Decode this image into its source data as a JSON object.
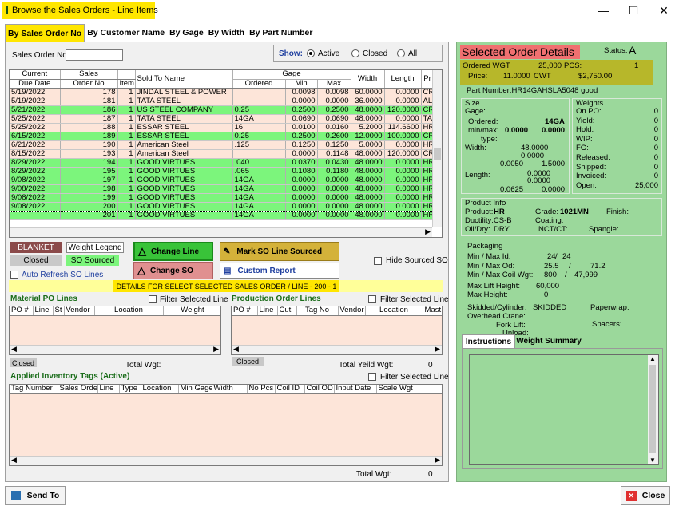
{
  "window": {
    "title": "Browse the Sales Orders - Line Items",
    "minimize": "—",
    "maximize": "☐",
    "close": "✕"
  },
  "tabs": [
    "By Sales Order No",
    "By Customer Name",
    "By Gage",
    "By Width",
    "By Part Number"
  ],
  "filters": {
    "sales_order_label": "Sales Order No:",
    "sales_order_value": "",
    "show_label": "Show:",
    "show_options": [
      "Active",
      "Closed",
      "All"
    ],
    "show_selected": "Active"
  },
  "main_grid": {
    "headers_top": [
      "Current",
      "Sales",
      "",
      "",
      "Gage",
      "",
      "",
      "",
      ""
    ],
    "headers": [
      "Due Date",
      "Order No",
      "Item",
      "Sold To Name",
      "Ordered",
      "Min",
      "Max",
      "Width",
      "Length",
      "Pr"
    ],
    "rows": [
      {
        "due": "5/19/2022",
        "order": "178",
        "item": "1",
        "name": "JINDAL STEEL & POWER",
        "ordered": "",
        "min": "0.0098",
        "max": "0.0098",
        "width": "60.0000",
        "length": "0.0000",
        "pr": "CR",
        "style": "pink"
      },
      {
        "due": "5/19/2022",
        "order": "181",
        "item": "1",
        "name": "TATA STEEL",
        "ordered": "",
        "min": "0.0000",
        "max": "0.0000",
        "width": "36.0000",
        "length": "0.0000",
        "pr": "AL",
        "style": "pink"
      },
      {
        "due": "5/21/2022",
        "order": "186",
        "item": "1",
        "name": "US STEEL COMPANY",
        "ordered": "0.25",
        "min": "0.2500",
        "max": "0.2500",
        "width": "48.0000",
        "length": "120.0000",
        "pr": "CR",
        "style": "green"
      },
      {
        "due": "5/25/2022",
        "order": "187",
        "item": "1",
        "name": "TATA STEEL",
        "ordered": "14GA",
        "min": "0.0690",
        "max": "0.0690",
        "width": "48.0000",
        "length": "0.0000",
        "pr": "TA",
        "style": "pink"
      },
      {
        "due": "5/25/2022",
        "order": "188",
        "item": "1",
        "name": "ESSAR STEEL",
        "ordered": "16",
        "min": "0.0100",
        "max": "0.0160",
        "width": "5.2000",
        "length": "114.6600",
        "pr": "HR",
        "style": "pink"
      },
      {
        "due": "6/15/2022",
        "order": "189",
        "item": "1",
        "name": "ESSAR STEEL",
        "ordered": "0.25",
        "min": "0.2500",
        "max": "0.2600",
        "width": "12.0000",
        "length": "100.0000",
        "pr": "CR",
        "style": "green"
      },
      {
        "due": "6/21/2022",
        "order": "190",
        "item": "1",
        "name": "American Steel",
        "ordered": ".125",
        "min": "0.1250",
        "max": "0.1250",
        "width": "5.0000",
        "length": "0.0000",
        "pr": "HR",
        "style": "pink"
      },
      {
        "due": "8/15/2022",
        "order": "193",
        "item": "1",
        "name": "American Steel",
        "ordered": "",
        "min": "0.0000",
        "max": "0.1148",
        "width": "48.0000",
        "length": "120.0000",
        "pr": "CR",
        "style": "pink"
      },
      {
        "due": "8/29/2022",
        "order": "194",
        "item": "1",
        "name": "GOOD VIRTUES",
        "ordered": ".040",
        "min": "0.0370",
        "max": "0.0430",
        "width": "48.0000",
        "length": "0.0000",
        "pr": "HR",
        "style": "green"
      },
      {
        "due": "8/29/2022",
        "order": "195",
        "item": "1",
        "name": "GOOD VIRTUES",
        "ordered": ".065",
        "min": "0.1080",
        "max": "0.1180",
        "width": "48.0000",
        "length": "0.0000",
        "pr": "HR",
        "style": "green"
      },
      {
        "due": "9/08/2022",
        "order": "197",
        "item": "1",
        "name": "GOOD VIRTUES",
        "ordered": "14GA",
        "min": "0.0000",
        "max": "0.0000",
        "width": "48.0000",
        "length": "0.0000",
        "pr": "HR",
        "style": "green"
      },
      {
        "due": "9/08/2022",
        "order": "198",
        "item": "1",
        "name": "GOOD VIRTUES",
        "ordered": "14GA",
        "min": "0.0000",
        "max": "0.0000",
        "width": "48.0000",
        "length": "0.0000",
        "pr": "HR",
        "style": "green"
      },
      {
        "due": "9/08/2022",
        "order": "199",
        "item": "1",
        "name": "GOOD VIRTUES",
        "ordered": "14GA",
        "min": "0.0000",
        "max": "0.0000",
        "width": "48.0000",
        "length": "0.0000",
        "pr": "HR",
        "style": "green"
      },
      {
        "due": "9/08/2022",
        "order": "200",
        "item": "1",
        "name": "GOOD VIRTUES",
        "ordered": "14GA",
        "min": "0.0000",
        "max": "0.0000",
        "width": "48.0000",
        "length": "0.0000",
        "pr": "HR",
        "style": "selrow"
      },
      {
        "due": "",
        "order": "201",
        "item": "1",
        "name": "GOOD VIRTUES",
        "ordered": "14GA",
        "min": "0.0000",
        "max": "0.0000",
        "width": "48.0000",
        "length": "0.0000",
        "pr": "HR",
        "style": "green"
      }
    ]
  },
  "legend": {
    "blanket": "BLANKET",
    "closed": "Closed",
    "weight_legend": "Weight Legend",
    "so_sourced": "SO Sourced",
    "auto_refresh": "Auto Refresh SO Lines"
  },
  "actions": {
    "change_line": "Change Line",
    "change_so": "Change SO",
    "mark_sourced": "Mark SO Line Sourced",
    "custom_report": "Custom Report",
    "hide_sourced": "Hide Sourced SO"
  },
  "details_banner": "DETAILS FOR SELECT SELECTED SALES ORDER / LINE - 200 - 1",
  "material_po": {
    "title": "Material PO Lines",
    "filter": "Filter Selected Line",
    "headers": [
      "PO #",
      "Line",
      "St",
      "Vendor",
      "Location",
      "Weight"
    ],
    "closed": "Closed",
    "total_label": "Total Wgt:",
    "total_value": ""
  },
  "production": {
    "title": "Production Order Lines",
    "filter": "Filter Selected Line",
    "headers": [
      "PO #",
      "Line",
      "Cut",
      "Tag No",
      "Vendor",
      "Location",
      "Mast"
    ],
    "closed": "Closed",
    "total_label": "Total Yeild Wgt:",
    "total_value": "0"
  },
  "inventory": {
    "title": "Applied Inventory Tags (Active)",
    "filter": "Filter Selected Line",
    "headers": [
      "Tag Number",
      "Sales Orde",
      "Line",
      "Type",
      "Location",
      "Min Gage",
      "Width",
      "No Pcs",
      "Coil ID",
      "Coil OD",
      "Input Date",
      "Scale Wgt"
    ],
    "total_label": "Total Wgt:",
    "total_value": "0"
  },
  "footer": {
    "send_to": "Send To",
    "close": "Close"
  },
  "details": {
    "title": "Selected Order Details",
    "status_label": "Status:",
    "status_value": "A",
    "ordered_wgt_label": "Ordered WGT",
    "ordered_wgt_value": "25,000",
    "pcs_label": "PCS:",
    "pcs_value": "1",
    "price_label": "Price:",
    "price_value": "11.0000",
    "price_unit": "CWT",
    "price_total": "$2,750.00",
    "part_number": "Part Number:HR14GAHSLA5048 good",
    "size": {
      "title": "Size",
      "gage_label": "Gage:",
      "ordered_label": "Ordered:",
      "ordered_value": "14GA",
      "minmax_label": "min/max:",
      "min_value": "0.0000",
      "max_value": "0.0000",
      "type_label": "type:",
      "width_label": "Width:",
      "width_value": "48.0000",
      "width_v2": "0.0000",
      "width_v3": "0.0050",
      "width_v4": "1.5000",
      "length_label": "Length:",
      "length_v1": "0.0000",
      "length_v2": "0.0000",
      "length_v3": "0.0625",
      "length_v4": "0.0000"
    },
    "weights": {
      "title": "Weights",
      "items": [
        {
          "label": "On PO:",
          "value": "0"
        },
        {
          "label": "Yield:",
          "value": "0"
        },
        {
          "label": "Hold:",
          "value": "0"
        },
        {
          "label": "WIP:",
          "value": "0"
        },
        {
          "label": "FG:",
          "value": "0"
        },
        {
          "label": "Released:",
          "value": "0"
        },
        {
          "label": "Shipped:",
          "value": "0"
        },
        {
          "label": "Invoiced:",
          "value": "0"
        },
        {
          "label": "Open:",
          "value": "25,000"
        }
      ]
    },
    "product": {
      "title": "Product Info",
      "product_label": "Product:",
      "product_value": "HR",
      "grade_label": "Grade:",
      "grade_value": "1021MN",
      "finish_label": "Finish:",
      "ductility": "Ductility:CS-B",
      "coating_label": "Coating:",
      "oil_label": "Oil/Dry:",
      "oil_value": "DRY",
      "nct_label": "NCT/CT:",
      "spangle_label": "Spangle:"
    },
    "packaging": {
      "title": "Packaging",
      "id_label": "Min / Max Id:",
      "id_min": "24",
      "id_max": "24",
      "od_label": "Min / Max Od:",
      "od_min": "25.5",
      "od_max": "71.2",
      "coil_label": "Min / Max Coil Wgt:",
      "coil_min": "800",
      "coil_max": "47,999",
      "lift_label": "Max Lift Height:",
      "lift_value": "60,000",
      "height_label": "Max Height:",
      "height_value": "0",
      "skid_label": "Skidded/Cylinder:",
      "skid_value": "SKIDDED",
      "paperwrap_label": "Paperwrap:",
      "crane_label": "Overhead Crane:",
      "fork_label": "Fork Lift:",
      "spacers_label": "Spacers:",
      "unload_label": "Unload:"
    },
    "tabs": [
      "Instructions",
      "Weight Summary"
    ]
  },
  "colors": {
    "highlight": "#ffe600",
    "green_row": "#7cf57c",
    "pink_row": "#fde5d9",
    "panel_green": "#9bd89b"
  }
}
